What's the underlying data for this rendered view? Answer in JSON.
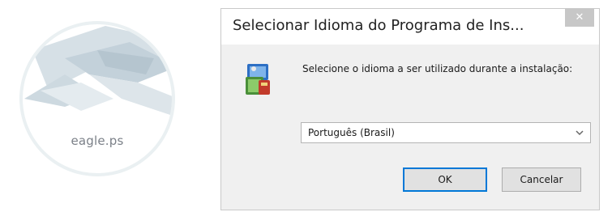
{
  "logo": {
    "brand_name": "eagle.ps",
    "icon": "eagle-ps-logo"
  },
  "dialog": {
    "title": "Selecionar Idioma do Programa de Ins...",
    "close_glyph": "✕",
    "icon": "setup-installer-icon",
    "message": "Selecione o idioma a ser utilizado durante a instalação:",
    "language_select": {
      "selected": "Português (Brasil)"
    },
    "ok_label": "OK",
    "cancel_label": "Cancelar"
  }
}
